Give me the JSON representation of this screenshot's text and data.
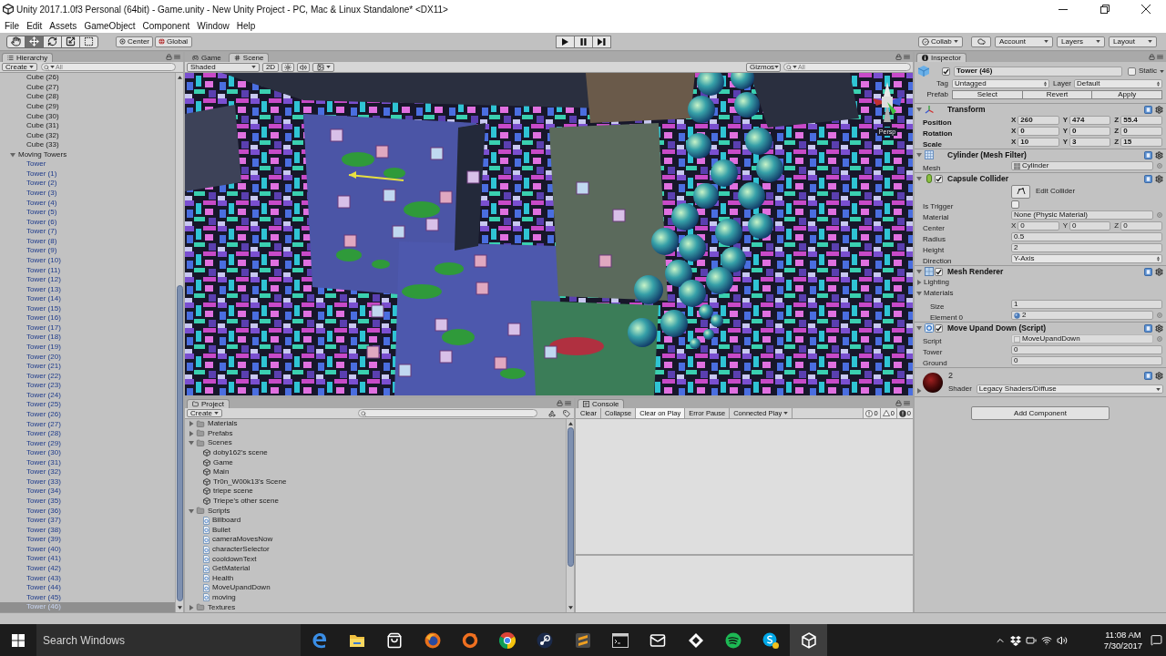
{
  "window": {
    "title": "Unity 2017.1.0f3 Personal (64bit) - Game.unity - New Unity Project - PC, Mac & Linux Standalone* <DX11>"
  },
  "menu": [
    "File",
    "Edit",
    "Assets",
    "GameObject",
    "Component",
    "Window",
    "Help"
  ],
  "toolbar": {
    "tools": [
      {
        "kind": "hand",
        "selected": false
      },
      {
        "kind": "move",
        "selected": true
      },
      {
        "kind": "rotate",
        "selected": false
      },
      {
        "kind": "scale",
        "selected": false
      },
      {
        "kind": "rect",
        "selected": false
      }
    ],
    "pivot": [
      {
        "kind": "center",
        "label": "Center"
      },
      {
        "kind": "global",
        "label": "Global"
      }
    ],
    "playback": [
      {
        "kind": "play"
      },
      {
        "kind": "pause"
      },
      {
        "kind": "step"
      }
    ],
    "services": [
      {
        "kind": "collab",
        "label": "Collab"
      },
      {
        "kind": "cloud"
      },
      {
        "kind": "menu",
        "label": "Account"
      },
      {
        "kind": "menu",
        "label": "Layers"
      },
      {
        "kind": "menu",
        "label": "Layout"
      }
    ]
  },
  "hierarchy": {
    "title": "Hierarchy",
    "create": "Create",
    "search_placeholder": "All",
    "items": [
      {
        "kind": "object",
        "label": "Cube (26)",
        "selected": false
      },
      {
        "kind": "object",
        "label": "Cube (27)",
        "selected": false
      },
      {
        "kind": "object",
        "label": "Cube (28)",
        "selected": false
      },
      {
        "kind": "object",
        "label": "Cube (29)",
        "selected": false
      },
      {
        "kind": "object",
        "label": "Cube (30)",
        "selected": false
      },
      {
        "kind": "object",
        "label": "Cube (31)",
        "selected": false
      },
      {
        "kind": "object",
        "label": "Cube (32)",
        "selected": false
      },
      {
        "kind": "object",
        "label": "Cube (33)",
        "selected": false
      },
      {
        "kind": "object",
        "label": "Moving Towers",
        "selected": false,
        "expanded": true,
        "children": [
          {
            "kind": "prefab",
            "label": "Tower",
            "selected": false
          },
          {
            "kind": "prefab",
            "label": "Tower (1)",
            "selected": false
          },
          {
            "kind": "prefab",
            "label": "Tower (2)",
            "selected": false
          },
          {
            "kind": "prefab",
            "label": "Tower (3)",
            "selected": false
          },
          {
            "kind": "prefab",
            "label": "Tower (4)",
            "selected": false
          },
          {
            "kind": "prefab",
            "label": "Tower (5)",
            "selected": false
          },
          {
            "kind": "prefab",
            "label": "Tower (6)",
            "selected": false
          },
          {
            "kind": "prefab",
            "label": "Tower (7)",
            "selected": false
          },
          {
            "kind": "prefab",
            "label": "Tower (8)",
            "selected": false
          },
          {
            "kind": "prefab",
            "label": "Tower (9)",
            "selected": false
          },
          {
            "kind": "prefab",
            "label": "Tower (10)",
            "selected": false
          },
          {
            "kind": "prefab",
            "label": "Tower (11)",
            "selected": false
          },
          {
            "kind": "prefab",
            "label": "Tower (12)",
            "selected": false
          },
          {
            "kind": "prefab",
            "label": "Tower (13)",
            "selected": false
          },
          {
            "kind": "prefab",
            "label": "Tower (14)",
            "selected": false
          },
          {
            "kind": "prefab",
            "label": "Tower (15)",
            "selected": false
          },
          {
            "kind": "prefab",
            "label": "Tower (16)",
            "selected": false
          },
          {
            "kind": "prefab",
            "label": "Tower (17)",
            "selected": false
          },
          {
            "kind": "prefab",
            "label": "Tower (18)",
            "selected": false
          },
          {
            "kind": "prefab",
            "label": "Tower (19)",
            "selected": false
          },
          {
            "kind": "prefab",
            "label": "Tower (20)",
            "selected": false
          },
          {
            "kind": "prefab",
            "label": "Tower (21)",
            "selected": false
          },
          {
            "kind": "prefab",
            "label": "Tower (22)",
            "selected": false
          },
          {
            "kind": "prefab",
            "label": "Tower (23)",
            "selected": false
          },
          {
            "kind": "prefab",
            "label": "Tower (24)",
            "selected": false
          },
          {
            "kind": "prefab",
            "label": "Tower (25)",
            "selected": false
          },
          {
            "kind": "prefab",
            "label": "Tower (26)",
            "selected": false
          },
          {
            "kind": "prefab",
            "label": "Tower (27)",
            "selected": false
          },
          {
            "kind": "prefab",
            "label": "Tower (28)",
            "selected": false
          },
          {
            "kind": "prefab",
            "label": "Tower (29)",
            "selected": false
          },
          {
            "kind": "prefab",
            "label": "Tower (30)",
            "selected": false
          },
          {
            "kind": "prefab",
            "label": "Tower (31)",
            "selected": false
          },
          {
            "kind": "prefab",
            "label": "Tower (32)",
            "selected": false
          },
          {
            "kind": "prefab",
            "label": "Tower (33)",
            "selected": false
          },
          {
            "kind": "prefab",
            "label": "Tower (34)",
            "selected": false
          },
          {
            "kind": "prefab",
            "label": "Tower (35)",
            "selected": false
          },
          {
            "kind": "prefab",
            "label": "Tower (36)",
            "selected": false
          },
          {
            "kind": "prefab",
            "label": "Tower (37)",
            "selected": false
          },
          {
            "kind": "prefab",
            "label": "Tower (38)",
            "selected": false
          },
          {
            "kind": "prefab",
            "label": "Tower (39)",
            "selected": false
          },
          {
            "kind": "prefab",
            "label": "Tower (40)",
            "selected": false
          },
          {
            "kind": "prefab",
            "label": "Tower (41)",
            "selected": false
          },
          {
            "kind": "prefab",
            "label": "Tower (42)",
            "selected": false
          },
          {
            "kind": "prefab",
            "label": "Tower (43)",
            "selected": false
          },
          {
            "kind": "prefab",
            "label": "Tower (44)",
            "selected": false
          },
          {
            "kind": "prefab",
            "label": "Tower (45)",
            "selected": false
          },
          {
            "kind": "prefab",
            "label": "Tower (46)",
            "selected": true
          }
        ]
      }
    ]
  },
  "scene": {
    "tabs": [
      {
        "kind": "game",
        "label": "Game",
        "selected": false
      },
      {
        "kind": "scene",
        "label": "Scene",
        "selected": true
      }
    ],
    "shading": "Shaded",
    "view_options": [
      {
        "kind": "mode",
        "label": "2D",
        "on": false
      },
      {
        "kind": "lighting",
        "on": false
      },
      {
        "kind": "audio",
        "on": false
      },
      {
        "kind": "effects",
        "on": false
      }
    ],
    "gizmos": "Gizmos",
    "search_placeholder": "All",
    "projection": "Persp"
  },
  "project": {
    "title": "Project",
    "create": "Create",
    "items": [
      {
        "kind": "folder",
        "label": "Materials",
        "expanded": false
      },
      {
        "kind": "folder",
        "label": "Prefabs",
        "expanded": false
      },
      {
        "kind": "folder",
        "label": "Scenes",
        "expanded": true,
        "children": [
          {
            "kind": "scene",
            "label": "doby162's scene"
          },
          {
            "kind": "scene",
            "label": "Game"
          },
          {
            "kind": "scene",
            "label": "Main"
          },
          {
            "kind": "scene",
            "label": "Tr0n_W00k13's Scene"
          },
          {
            "kind": "scene",
            "label": "triepe scene"
          },
          {
            "kind": "scene",
            "label": "Triepe's other scene"
          }
        ]
      },
      {
        "kind": "folder",
        "label": "Scripts",
        "expanded": true,
        "children": [
          {
            "kind": "script",
            "label": "Billboard"
          },
          {
            "kind": "script",
            "label": "Bullet"
          },
          {
            "kind": "script",
            "label": "cameraMovesNow"
          },
          {
            "kind": "script",
            "label": "characterSelector"
          },
          {
            "kind": "script",
            "label": "cooldownText"
          },
          {
            "kind": "script",
            "label": "GetMaterial"
          },
          {
            "kind": "script",
            "label": "Health"
          },
          {
            "kind": "script",
            "label": "MoveUpandDown"
          },
          {
            "kind": "script",
            "label": "moving"
          }
        ]
      },
      {
        "kind": "folder",
        "label": "Textures",
        "expanded": false
      }
    ]
  },
  "console": {
    "title": "Console",
    "toolbar": [
      {
        "kind": "button",
        "label": "Clear"
      },
      {
        "kind": "toggle",
        "label": "Collapse",
        "on": false
      },
      {
        "kind": "toggle",
        "label": "Clear on Play",
        "on": true
      },
      {
        "kind": "toggle",
        "label": "Error Pause",
        "on": false
      },
      {
        "kind": "dropdown",
        "label": "Connected Play"
      }
    ],
    "counts": [
      {
        "kind": "info",
        "count": "0"
      },
      {
        "kind": "warning",
        "count": "0"
      },
      {
        "kind": "error",
        "count": "0"
      }
    ]
  },
  "inspector": {
    "title": "Inspector",
    "object": {
      "active": true,
      "name": "Tower (46)",
      "static": false,
      "static_label": "Static",
      "tag_label": "Tag",
      "tag": "Untagged",
      "layer_label": "Layer",
      "layer": "Default",
      "prefab_label": "Prefab",
      "prefab_buttons": [
        "Select",
        "Revert",
        "Apply"
      ]
    },
    "components": [
      {
        "kind": "transform",
        "title": "Transform",
        "expanded": true,
        "fields": [
          {
            "kind": "vector",
            "label": "Position",
            "modified": true,
            "values": [
              {
                "axis": "X",
                "value": "260"
              },
              {
                "axis": "Y",
                "value": "474"
              },
              {
                "axis": "Z",
                "value": "55.4"
              }
            ]
          },
          {
            "kind": "vector",
            "label": "Rotation",
            "modified": true,
            "values": [
              {
                "axis": "X",
                "value": "0"
              },
              {
                "axis": "Y",
                "value": "0"
              },
              {
                "axis": "Z",
                "value": "0"
              }
            ]
          },
          {
            "kind": "vector",
            "label": "Scale",
            "modified": true,
            "values": [
              {
                "axis": "X",
                "value": "10"
              },
              {
                "axis": "Y",
                "value": "3"
              },
              {
                "axis": "Z",
                "value": "15"
              }
            ]
          }
        ]
      },
      {
        "kind": "mesh_filter",
        "title": "Cylinder (Mesh Filter)",
        "expanded": true,
        "fields": [
          {
            "kind": "mesh",
            "label": "Mesh",
            "value": "Cylinder",
            "modified": false,
            "disabled": false
          }
        ]
      },
      {
        "kind": "collider",
        "title": "Capsule Collider",
        "enabled": true,
        "expanded": true,
        "fields": [
          {
            "kind": "edit_button",
            "label": "Edit Collider"
          },
          {
            "kind": "checkbox",
            "label": "Is Trigger",
            "checked": false,
            "modified": false
          },
          {
            "kind": "reference",
            "label": "Material",
            "value": "None (Physic Material)",
            "modified": false,
            "disabled": false
          },
          {
            "kind": "vector",
            "label": "Center",
            "modified": false,
            "values": [
              {
                "axis": "X",
                "value": "0"
              },
              {
                "axis": "Y",
                "value": "0"
              },
              {
                "axis": "Z",
                "value": "0"
              }
            ]
          },
          {
            "kind": "number",
            "label": "Radius",
            "value": "0.5",
            "modified": false
          },
          {
            "kind": "number",
            "label": "Height",
            "value": "2",
            "modified": false
          },
          {
            "kind": "dropdown",
            "label": "Direction",
            "value": "Y-Axis",
            "modified": false
          }
        ]
      },
      {
        "kind": "renderer",
        "title": "Mesh Renderer",
        "enabled": true,
        "expanded": true,
        "fields": [
          {
            "kind": "foldout",
            "label": "Lighting",
            "expanded": false
          },
          {
            "kind": "foldout",
            "label": "Materials",
            "expanded": true,
            "children": [
              {
                "kind": "number",
                "label": "Size",
                "value": "1",
                "modified": false
              },
              {
                "kind": "material",
                "label": "Element 0",
                "value": "2",
                "modified": false,
                "disabled": false
              }
            ]
          }
        ]
      },
      {
        "kind": "script",
        "title": "Move Upand Down (Script)",
        "enabled": true,
        "expanded": true,
        "fields": [
          {
            "kind": "script",
            "label": "Script",
            "value": "MoveUpandDown",
            "modified": false,
            "disabled": true
          },
          {
            "kind": "number",
            "label": "Tower",
            "value": "0",
            "modified": false
          },
          {
            "kind": "number",
            "label": "Ground",
            "value": "0",
            "modified": false
          }
        ]
      },
      {
        "kind": "material",
        "title": "2",
        "expanded": false,
        "shader_label": "Shader",
        "shader": "Legacy Shaders/Diffuse"
      }
    ],
    "add_component": "Add Component"
  },
  "taskbar": {
    "search_placeholder": "Search Windows",
    "apps": [
      {
        "kind": "edge",
        "active": false
      },
      {
        "kind": "explorer",
        "active": false
      },
      {
        "kind": "store",
        "active": false
      },
      {
        "kind": "firefox",
        "active": false
      },
      {
        "kind": "ring",
        "active": false
      },
      {
        "kind": "chrome",
        "active": false
      },
      {
        "kind": "steam",
        "active": false
      },
      {
        "kind": "sublime",
        "active": false
      },
      {
        "kind": "terminal",
        "active": false
      },
      {
        "kind": "mail",
        "active": false
      },
      {
        "kind": "diamond",
        "active": false
      },
      {
        "kind": "spotify",
        "active": false
      },
      {
        "kind": "skype",
        "active": false
      },
      {
        "kind": "unity",
        "active": true
      }
    ],
    "tray": [
      {
        "kind": "chevron"
      },
      {
        "kind": "dropbox"
      },
      {
        "kind": "battery"
      },
      {
        "kind": "wifi"
      },
      {
        "kind": "volume"
      }
    ],
    "time": "11:08 AM",
    "date": "7/30/2017"
  }
}
